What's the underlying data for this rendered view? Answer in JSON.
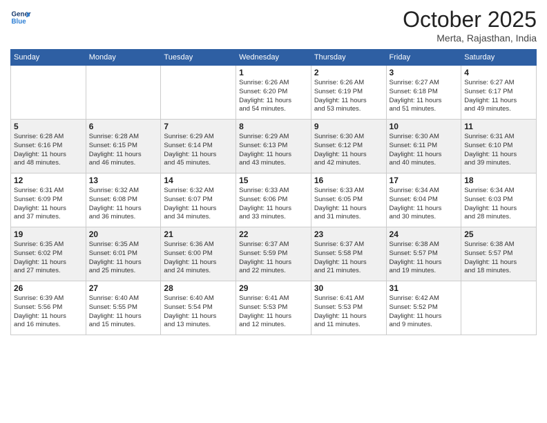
{
  "logo": {
    "line1": "General",
    "line2": "Blue"
  },
  "header": {
    "month": "October 2025",
    "location": "Merta, Rajasthan, India"
  },
  "days_of_week": [
    "Sunday",
    "Monday",
    "Tuesday",
    "Wednesday",
    "Thursday",
    "Friday",
    "Saturday"
  ],
  "weeks": [
    [
      {
        "num": "",
        "info": ""
      },
      {
        "num": "",
        "info": ""
      },
      {
        "num": "",
        "info": ""
      },
      {
        "num": "1",
        "info": "Sunrise: 6:26 AM\nSunset: 6:20 PM\nDaylight: 11 hours\nand 54 minutes."
      },
      {
        "num": "2",
        "info": "Sunrise: 6:26 AM\nSunset: 6:19 PM\nDaylight: 11 hours\nand 53 minutes."
      },
      {
        "num": "3",
        "info": "Sunrise: 6:27 AM\nSunset: 6:18 PM\nDaylight: 11 hours\nand 51 minutes."
      },
      {
        "num": "4",
        "info": "Sunrise: 6:27 AM\nSunset: 6:17 PM\nDaylight: 11 hours\nand 49 minutes."
      }
    ],
    [
      {
        "num": "5",
        "info": "Sunrise: 6:28 AM\nSunset: 6:16 PM\nDaylight: 11 hours\nand 48 minutes."
      },
      {
        "num": "6",
        "info": "Sunrise: 6:28 AM\nSunset: 6:15 PM\nDaylight: 11 hours\nand 46 minutes."
      },
      {
        "num": "7",
        "info": "Sunrise: 6:29 AM\nSunset: 6:14 PM\nDaylight: 11 hours\nand 45 minutes."
      },
      {
        "num": "8",
        "info": "Sunrise: 6:29 AM\nSunset: 6:13 PM\nDaylight: 11 hours\nand 43 minutes."
      },
      {
        "num": "9",
        "info": "Sunrise: 6:30 AM\nSunset: 6:12 PM\nDaylight: 11 hours\nand 42 minutes."
      },
      {
        "num": "10",
        "info": "Sunrise: 6:30 AM\nSunset: 6:11 PM\nDaylight: 11 hours\nand 40 minutes."
      },
      {
        "num": "11",
        "info": "Sunrise: 6:31 AM\nSunset: 6:10 PM\nDaylight: 11 hours\nand 39 minutes."
      }
    ],
    [
      {
        "num": "12",
        "info": "Sunrise: 6:31 AM\nSunset: 6:09 PM\nDaylight: 11 hours\nand 37 minutes."
      },
      {
        "num": "13",
        "info": "Sunrise: 6:32 AM\nSunset: 6:08 PM\nDaylight: 11 hours\nand 36 minutes."
      },
      {
        "num": "14",
        "info": "Sunrise: 6:32 AM\nSunset: 6:07 PM\nDaylight: 11 hours\nand 34 minutes."
      },
      {
        "num": "15",
        "info": "Sunrise: 6:33 AM\nSunset: 6:06 PM\nDaylight: 11 hours\nand 33 minutes."
      },
      {
        "num": "16",
        "info": "Sunrise: 6:33 AM\nSunset: 6:05 PM\nDaylight: 11 hours\nand 31 minutes."
      },
      {
        "num": "17",
        "info": "Sunrise: 6:34 AM\nSunset: 6:04 PM\nDaylight: 11 hours\nand 30 minutes."
      },
      {
        "num": "18",
        "info": "Sunrise: 6:34 AM\nSunset: 6:03 PM\nDaylight: 11 hours\nand 28 minutes."
      }
    ],
    [
      {
        "num": "19",
        "info": "Sunrise: 6:35 AM\nSunset: 6:02 PM\nDaylight: 11 hours\nand 27 minutes."
      },
      {
        "num": "20",
        "info": "Sunrise: 6:35 AM\nSunset: 6:01 PM\nDaylight: 11 hours\nand 25 minutes."
      },
      {
        "num": "21",
        "info": "Sunrise: 6:36 AM\nSunset: 6:00 PM\nDaylight: 11 hours\nand 24 minutes."
      },
      {
        "num": "22",
        "info": "Sunrise: 6:37 AM\nSunset: 5:59 PM\nDaylight: 11 hours\nand 22 minutes."
      },
      {
        "num": "23",
        "info": "Sunrise: 6:37 AM\nSunset: 5:58 PM\nDaylight: 11 hours\nand 21 minutes."
      },
      {
        "num": "24",
        "info": "Sunrise: 6:38 AM\nSunset: 5:57 PM\nDaylight: 11 hours\nand 19 minutes."
      },
      {
        "num": "25",
        "info": "Sunrise: 6:38 AM\nSunset: 5:57 PM\nDaylight: 11 hours\nand 18 minutes."
      }
    ],
    [
      {
        "num": "26",
        "info": "Sunrise: 6:39 AM\nSunset: 5:56 PM\nDaylight: 11 hours\nand 16 minutes."
      },
      {
        "num": "27",
        "info": "Sunrise: 6:40 AM\nSunset: 5:55 PM\nDaylight: 11 hours\nand 15 minutes."
      },
      {
        "num": "28",
        "info": "Sunrise: 6:40 AM\nSunset: 5:54 PM\nDaylight: 11 hours\nand 13 minutes."
      },
      {
        "num": "29",
        "info": "Sunrise: 6:41 AM\nSunset: 5:53 PM\nDaylight: 11 hours\nand 12 minutes."
      },
      {
        "num": "30",
        "info": "Sunrise: 6:41 AM\nSunset: 5:53 PM\nDaylight: 11 hours\nand 11 minutes."
      },
      {
        "num": "31",
        "info": "Sunrise: 6:42 AM\nSunset: 5:52 PM\nDaylight: 11 hours\nand 9 minutes."
      },
      {
        "num": "",
        "info": ""
      }
    ]
  ]
}
